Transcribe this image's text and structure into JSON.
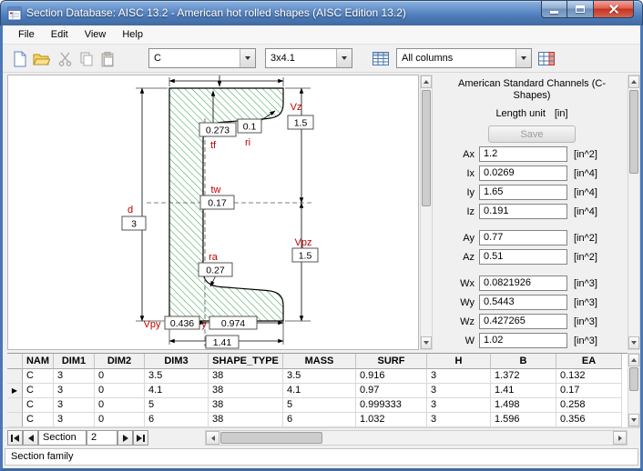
{
  "window": {
    "title": "Section Database: AISC 13.2 - American hot rolled shapes (AISC Edition 13.2)"
  },
  "menu": {
    "items": [
      "File",
      "Edit",
      "View",
      "Help"
    ]
  },
  "toolbar": {
    "family_combo": {
      "value": "C"
    },
    "section_combo": {
      "value": "3x4.1"
    },
    "columns_combo": {
      "value": "All columns"
    }
  },
  "drawing": {
    "labels": {
      "d": "d",
      "tf": "tf",
      "ri": "ri",
      "tw": "tw",
      "ra": "ra",
      "vz": "Vz",
      "vpz": "Vpz",
      "vpy": "Vpy",
      "y": "y"
    },
    "values": {
      "tf": "0.273",
      "ri": "0.1",
      "vz": "1.5",
      "tw": "0.17",
      "d": "3",
      "ra": "0.27",
      "vpz": "1.5",
      "vpy": "0.436",
      "y": "0.974",
      "b": "1.41"
    }
  },
  "properties": {
    "title": "American Standard Channels (C-Shapes)",
    "length_unit_label": "Length unit",
    "length_unit_value": "[in]",
    "save_label": "Save",
    "groups": [
      {
        "fields": [
          {
            "name": "Ax",
            "value": "1.2",
            "unit": "[in^2]"
          },
          {
            "name": "Ix",
            "value": "0.0269",
            "unit": "[in^4]"
          },
          {
            "name": "Iy",
            "value": "1.65",
            "unit": "[in^4]"
          },
          {
            "name": "Iz",
            "value": "0.191",
            "unit": "[in^4]"
          }
        ]
      },
      {
        "fields": [
          {
            "name": "Ay",
            "value": "0.77",
            "unit": "[in^2]"
          },
          {
            "name": "Az",
            "value": "0.51",
            "unit": "[in^2]"
          }
        ]
      },
      {
        "fields": [
          {
            "name": "Wx",
            "value": "0.0821926",
            "unit": "[in^3]"
          },
          {
            "name": "Wy",
            "value": "0.5443",
            "unit": "[in^3]"
          },
          {
            "name": "Wz",
            "value": "0.427265",
            "unit": "[in^3]"
          },
          {
            "name": "W",
            "value": "1.02",
            "unit": "[in^3]"
          }
        ]
      }
    ]
  },
  "table": {
    "columns": [
      "NAM",
      "DIM1",
      "DIM2",
      "DIM3",
      "SHAPE_TYPE",
      "MASS",
      "SURF",
      "H",
      "B",
      "EA"
    ],
    "rows": [
      [
        "C",
        "3",
        "0",
        "3.5",
        "38",
        "3.5",
        "0.916",
        "3",
        "1.372",
        "0.132"
      ],
      [
        "C",
        "3",
        "0",
        "4.1",
        "38",
        "4.1",
        "0.97",
        "3",
        "1.41",
        "0.17"
      ],
      [
        "C",
        "3",
        "0",
        "5",
        "38",
        "5",
        "0.999333",
        "3",
        "1.498",
        "0.258"
      ],
      [
        "C",
        "3",
        "0",
        "6",
        "38",
        "6",
        "1.032",
        "3",
        "1.596",
        "0.356"
      ]
    ],
    "selected_index": 1,
    "row_marker": "▶"
  },
  "navigator": {
    "label": "Section",
    "value": "2"
  },
  "status": {
    "text": "Section family"
  }
}
